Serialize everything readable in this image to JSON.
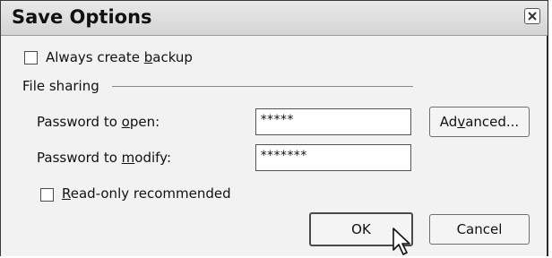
{
  "window": {
    "title": "Save Options"
  },
  "backup": {
    "label_pre": "Always create ",
    "label_key": "b",
    "label_post": "ackup",
    "checked": false
  },
  "file_sharing": {
    "group_label": "File sharing",
    "password_open": {
      "label_pre": "Password to ",
      "label_key": "o",
      "label_post": "pen:",
      "value": "*****"
    },
    "password_modify": {
      "label_pre": "Password to ",
      "label_key": "m",
      "label_post": "odify:",
      "value": "*******"
    },
    "readonly": {
      "label_key": "R",
      "label_post": "ead-only recommended",
      "checked": false
    }
  },
  "buttons": {
    "advanced": {
      "pre": "Ad",
      "key": "v",
      "post": "anced..."
    },
    "ok": "OK",
    "cancel": "Cancel"
  },
  "icons": {
    "close": "close-icon",
    "cursor": "mouse-pointer-icon"
  }
}
